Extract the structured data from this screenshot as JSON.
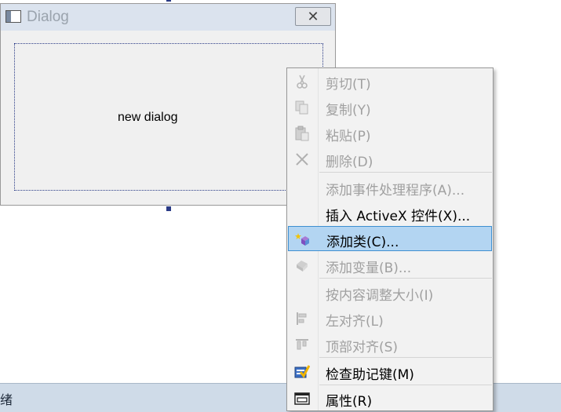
{
  "dialog": {
    "title": "Dialog",
    "close_label": "✕",
    "canvas_label": "new dialog"
  },
  "statusbar": {
    "text": "绪"
  },
  "context_menu": {
    "items": [
      {
        "label": "剪切(T)",
        "icon": "scissors-icon",
        "enabled": false
      },
      {
        "label": "复制(Y)",
        "icon": "copy-icon",
        "enabled": false
      },
      {
        "label": "粘贴(P)",
        "icon": "paste-icon",
        "enabled": false
      },
      {
        "label": "删除(D)",
        "icon": "delete-icon",
        "enabled": false
      },
      {
        "label": "添加事件处理程序(A)...",
        "icon": "",
        "enabled": false
      },
      {
        "label": "插入 ActiveX 控件(X)...",
        "icon": "",
        "enabled": true
      },
      {
        "label": "添加类(C)...",
        "icon": "add-class-icon",
        "enabled": true,
        "highlighted": true
      },
      {
        "label": "添加变量(B)...",
        "icon": "add-variable-icon",
        "enabled": false
      },
      {
        "label": "按内容调整大小(I)",
        "icon": "",
        "enabled": false
      },
      {
        "label": "左对齐(L)",
        "icon": "align-left-icon",
        "enabled": false
      },
      {
        "label": "顶部对齐(S)",
        "icon": "align-top-icon",
        "enabled": false
      },
      {
        "label": "检查助记键(M)",
        "icon": "check-mnemonics-icon",
        "enabled": true
      },
      {
        "label": "属性(R)",
        "icon": "properties-icon",
        "enabled": true
      }
    ]
  },
  "colors": {
    "highlight_bg": "#b3d5f2",
    "highlight_border": "#3e8fd1",
    "disabled_text": "#a0a0a0",
    "statusbar_bg": "#cfdbe8"
  }
}
